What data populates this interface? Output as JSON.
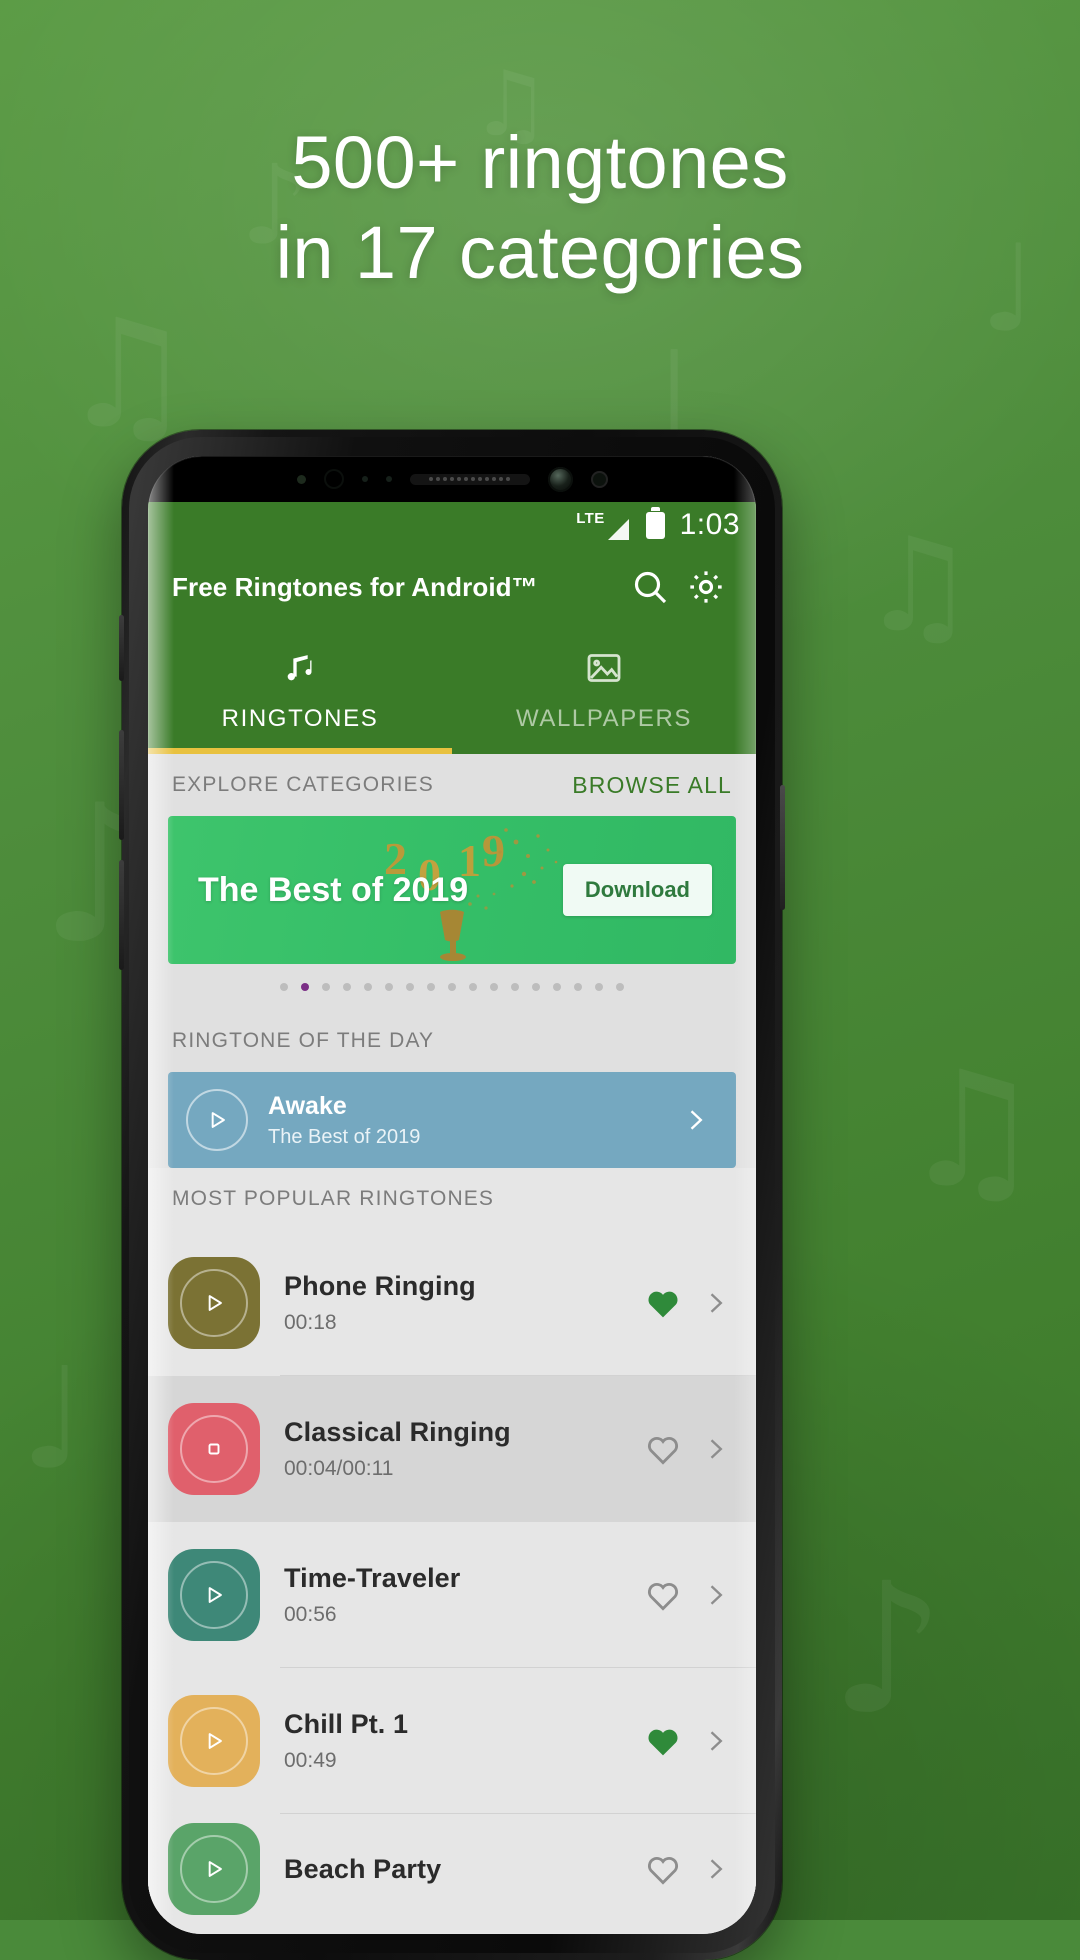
{
  "promo": {
    "headline_line1": "500+ ringtones",
    "headline_line2": "in 17 categories",
    "background_color": "#4a8a3a"
  },
  "phone": {
    "status_bar": {
      "network": "LTE",
      "time": "1:03",
      "signal_icon": "signal-bars-icon",
      "battery_icon": "battery-full-icon"
    },
    "app": {
      "title": "Free Ringtones for Android™",
      "accent_color": "#3a7b28",
      "tab_indicator_color": "#e8c13f",
      "actions": [
        {
          "name": "search-icon",
          "label": "Search"
        },
        {
          "name": "gear-icon",
          "label": "Settings"
        }
      ],
      "tabs": [
        {
          "label": "RINGTONES",
          "icon": "music-note-icon",
          "active": true
        },
        {
          "label": "WALLPAPERS",
          "icon": "image-icon",
          "active": false
        }
      ],
      "sections": {
        "explore": {
          "label": "EXPLORE CATEGORIES",
          "action": "BROWSE ALL"
        },
        "banner": {
          "title": "The Best of 2019",
          "button": "Download",
          "color": "#35bf68",
          "artwork_label": "2019-confetti-artwork"
        },
        "carousel": {
          "total_dots": 17,
          "active_index": 1,
          "active_dot_color": "#7b2f86"
        },
        "ringtone_of_the_day": {
          "label": "RINGTONE OF THE DAY",
          "title": "Awake",
          "subtitle": "The Best of 2019",
          "card_color": "#75a8c0",
          "play_icon": "play-icon",
          "chevron_icon": "chevron-right-icon"
        },
        "most_popular": {
          "label": "MOST POPULAR RINGTONES",
          "items": [
            {
              "title": "Phone Ringing",
              "duration": "00:18",
              "thumb_color": "#7b7234",
              "state_icon": "play-icon",
              "favorite": true,
              "playing": false
            },
            {
              "title": "Classical Ringing",
              "duration": "00:04/00:11",
              "thumb_color": "#e0606c",
              "state_icon": "stop-icon",
              "favorite": false,
              "playing": true
            },
            {
              "title": "Time-Traveler",
              "duration": "00:56",
              "thumb_color": "#3e8878",
              "state_icon": "play-icon",
              "favorite": false,
              "playing": false
            },
            {
              "title": "Chill Pt. 1",
              "duration": "00:49",
              "thumb_color": "#e3b15b",
              "state_icon": "play-icon",
              "favorite": true,
              "playing": false
            },
            {
              "title": "Beach Party",
              "duration": "",
              "thumb_color": "#5aa469",
              "state_icon": "play-icon",
              "favorite": false,
              "playing": false
            }
          ],
          "favorite_on_color": "#2f8a3a",
          "favorite_off_color": "#8d8d8d"
        }
      }
    }
  }
}
